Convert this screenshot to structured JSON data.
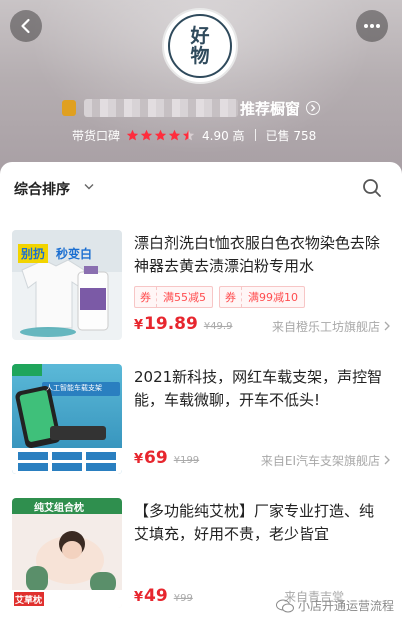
{
  "header": {
    "logo_top": "好",
    "logo_bottom": "物",
    "shop_title": "推荐橱窗",
    "reputation_label": "带货口碑",
    "rating_stars": 4.5,
    "rating_score": "4.90 高",
    "sold": "已售 758"
  },
  "sort": {
    "label": "综合排序"
  },
  "products": [
    {
      "title": "漂白剂洗白t恤衣服白色衣物染色去除神器去黄去渍漂泊粉专用水",
      "coupons": [
        {
          "tag": "券",
          "value": "满55减5"
        },
        {
          "tag": "券",
          "value": "满99减10"
        }
      ],
      "price": "19.89",
      "currency": "¥",
      "orig_price": "¥49.9",
      "source": "来自橙乐工坊旗舰店",
      "thumb_text_1": "别扔",
      "thumb_text_2": "秒变白"
    },
    {
      "title": "2021新科技，网红车载支架，声控智能，车载微聊，开车不低头!",
      "price": "69",
      "currency": "¥",
      "orig_price": "¥199",
      "source": "来自EI汽车支架旗舰店",
      "thumb_text_1": "人工智能车载支架"
    },
    {
      "title": "【多功能纯艾枕】厂家专业打造、纯艾填充，好用不贵，老少皆宜",
      "price": "49",
      "currency": "¥",
      "orig_price": "¥99",
      "source": "来自青吉堂",
      "thumb_text_1": "纯艾组合枕",
      "thumb_text_2": "艾草枕"
    }
  ],
  "watermark": "小店开通运营流程",
  "colors": {
    "price_red": "#e7262e",
    "coupon_red": "#ff4d4f",
    "star_red": "#ff2d3d"
  }
}
